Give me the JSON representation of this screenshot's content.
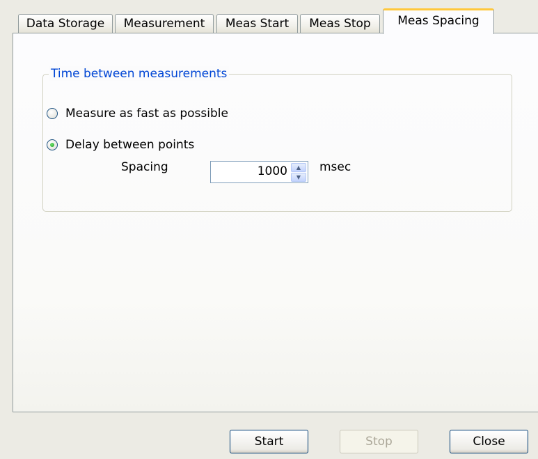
{
  "tabs": [
    {
      "label": "Data Storage",
      "active": false
    },
    {
      "label": "Measurement",
      "active": false
    },
    {
      "label": "Meas Start",
      "active": false
    },
    {
      "label": "Meas Stop",
      "active": false
    },
    {
      "label": "Meas Spacing",
      "active": true
    }
  ],
  "group": {
    "title": "Time between measurements"
  },
  "options": [
    {
      "label": "Measure as fast as possible",
      "checked": false
    },
    {
      "label": "Delay between points",
      "checked": true
    }
  ],
  "spacing": {
    "label": "Spacing",
    "value": "1000",
    "unit": "msec"
  },
  "buttons": {
    "start": "Start",
    "stop": "Stop",
    "close": "Close"
  },
  "colors": {
    "active_tab_accent": "#ffc83c",
    "group_title": "#0046d5",
    "radio_checked": "#21a121"
  }
}
